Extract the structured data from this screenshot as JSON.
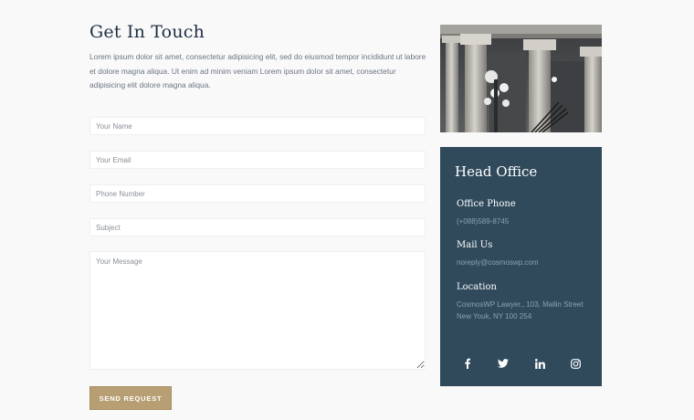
{
  "contact": {
    "heading": "Get In Touch",
    "intro": "Lorem ipsum dolor sit amet, consectetur adipisicing elit, sed do eiusmod tempor incididunt ut labore et dolore magna aliqua. Ut enim ad minim veniam Lorem ipsum dolor sit amet, consectetur adipisicing elit dolore magna aliqua.",
    "form": {
      "name_placeholder": "Your Name",
      "email_placeholder": "Your Email",
      "phone_placeholder": "Phone Number",
      "subject_placeholder": "Subject",
      "message_placeholder": "Your Message",
      "submit_label": "SEND REQUEST"
    }
  },
  "office": {
    "title": "Head Office",
    "phone_label": "Office Phone",
    "phone": "(+088)589-8745",
    "mail_label": "Mail Us",
    "mail": "noreply@cosmoswp.com",
    "location_label": "Location",
    "address_line1": "CosmosWP Lawyer., 103, Mallin Street",
    "address_line2": "New Youk, NY 100 254",
    "social": [
      "facebook-icon",
      "twitter-icon",
      "linkedin-icon",
      "instagram-icon"
    ]
  },
  "colors": {
    "heading": "#1f2f44",
    "button": "#b79e73",
    "panel": "#304a5c"
  }
}
